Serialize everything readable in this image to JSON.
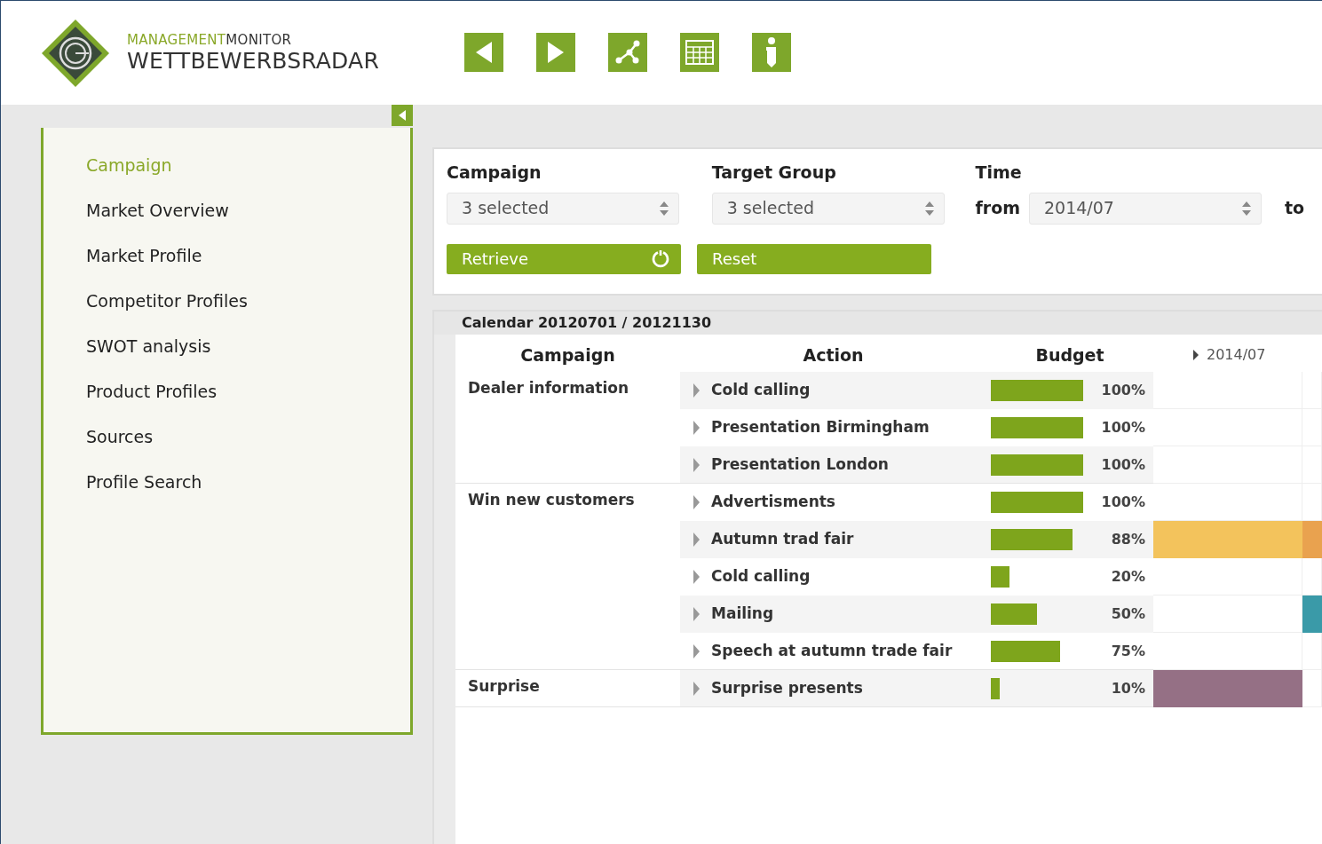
{
  "brand": {
    "line_1a": "MANAGEMENT",
    "line_1b": "MONITOR",
    "line_2": "WETTBEWERBSRADAR"
  },
  "toolbar": [
    {
      "kind": "back"
    },
    {
      "kind": "forward"
    },
    {
      "kind": "share"
    },
    {
      "kind": "table"
    },
    {
      "kind": "info"
    }
  ],
  "sidebar": {
    "items": [
      {
        "label": "Campaign",
        "selected": true
      },
      {
        "label": "Market Overview",
        "selected": false
      },
      {
        "label": "Market Profile",
        "selected": false
      },
      {
        "label": "Competitor Profiles",
        "selected": false
      },
      {
        "label": "SWOT analysis",
        "selected": false
      },
      {
        "label": "Product Profiles",
        "selected": false
      },
      {
        "label": "Sources",
        "selected": false
      },
      {
        "label": "Profile Search",
        "selected": false
      }
    ]
  },
  "filters": {
    "campaign": {
      "label": "Campaign",
      "value": "3 selected"
    },
    "target_group": {
      "label": "Target Group",
      "value": "3 selected"
    },
    "time": {
      "label": "Time",
      "from_label": "from",
      "from_value": "2014/07",
      "to_label": "to"
    },
    "buttons": [
      {
        "label": "Retrieve",
        "kind": "refresh"
      },
      {
        "label": "Reset",
        "kind": "plain"
      }
    ]
  },
  "calendar": {
    "title": "Calendar 20120701 / 20121130",
    "columns": [
      "Campaign",
      "Action",
      "Budget"
    ],
    "timeline_header": "2014/07",
    "groups": [
      {
        "campaign": "Dealer information",
        "actions": [
          {
            "name": "Cold calling",
            "budget": "100%",
            "timeline": [
              {
                "filled": false
              },
              {
                "filled": false
              }
            ]
          },
          {
            "name": "Presentation Birmingham",
            "budget": "100%",
            "timeline": [
              {
                "filled": false
              },
              {
                "filled": false
              }
            ]
          },
          {
            "name": "Presentation London",
            "budget": "100%",
            "timeline": [
              {
                "filled": false
              },
              {
                "filled": false
              }
            ]
          }
        ]
      },
      {
        "campaign": "Win new customers",
        "actions": [
          {
            "name": "Advertisments",
            "budget": "100%",
            "timeline": [
              {
                "filled": false
              },
              {
                "filled": false
              }
            ]
          },
          {
            "name": "Autumn trad fair",
            "budget": "88%",
            "timeline": [
              {
                "filled": true,
                "color": "#f3c35c"
              },
              {
                "filled": true,
                "color": "#e9a24f"
              }
            ]
          },
          {
            "name": "Cold calling",
            "budget": "20%",
            "timeline": [
              {
                "filled": false
              },
              {
                "filled": false
              }
            ]
          },
          {
            "name": "Mailing",
            "budget": "50%",
            "timeline": [
              {
                "filled": false
              },
              {
                "filled": true,
                "color": "#3a9aa8"
              }
            ]
          },
          {
            "name": "Speech at autumn trade fair",
            "budget": "75%",
            "timeline": [
              {
                "filled": false
              },
              {
                "filled": false
              }
            ]
          }
        ]
      },
      {
        "campaign": "Surprise",
        "actions": [
          {
            "name": "Surprise presents",
            "budget": "10%",
            "timeline": [
              {
                "filled": true,
                "color": "#957085"
              },
              {
                "filled": false
              }
            ]
          }
        ]
      }
    ]
  }
}
